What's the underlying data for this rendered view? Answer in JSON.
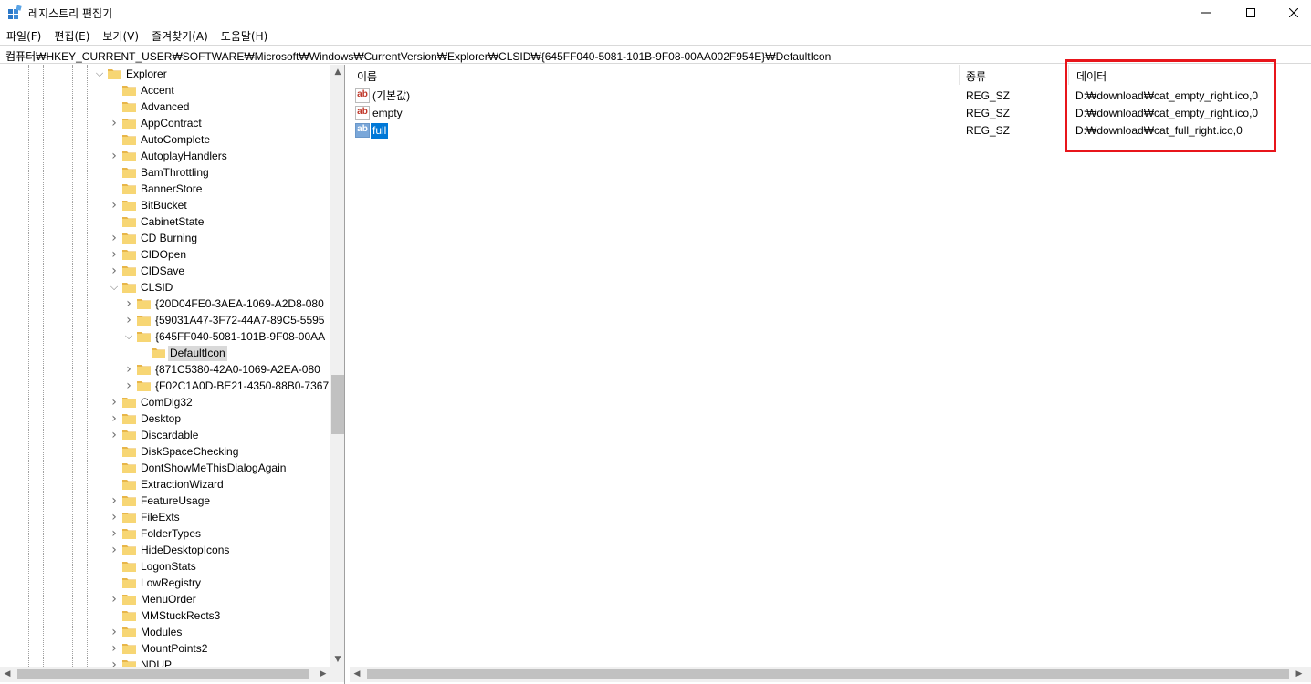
{
  "window": {
    "title": "레지스트리 편집기",
    "controls": {
      "minimize": "—",
      "maximize": "☐",
      "close": "✕"
    }
  },
  "menu": [
    "파일(F)",
    "편집(E)",
    "보기(V)",
    "즐겨찾기(A)",
    "도움말(H)"
  ],
  "address": "컴퓨터₩HKEY_CURRENT_USER₩SOFTWARE₩Microsoft₩Windows₩CurrentVersion₩Explorer₩CLSID₩{645FF040-5081-101B-9F08-00AA002F954E}₩DefaultIcon",
  "tree": {
    "items": [
      {
        "label": "Explorer",
        "level": 0,
        "expander": "open"
      },
      {
        "label": "Accent",
        "level": 1,
        "expander": "none"
      },
      {
        "label": "Advanced",
        "level": 1,
        "expander": "none"
      },
      {
        "label": "AppContract",
        "level": 1,
        "expander": "closed"
      },
      {
        "label": "AutoComplete",
        "level": 1,
        "expander": "none"
      },
      {
        "label": "AutoplayHandlers",
        "level": 1,
        "expander": "closed"
      },
      {
        "label": "BamThrottling",
        "level": 1,
        "expander": "none"
      },
      {
        "label": "BannerStore",
        "level": 1,
        "expander": "none"
      },
      {
        "label": "BitBucket",
        "level": 1,
        "expander": "closed"
      },
      {
        "label": "CabinetState",
        "level": 1,
        "expander": "none"
      },
      {
        "label": "CD Burning",
        "level": 1,
        "expander": "closed"
      },
      {
        "label": "CIDOpen",
        "level": 1,
        "expander": "closed"
      },
      {
        "label": "CIDSave",
        "level": 1,
        "expander": "closed"
      },
      {
        "label": "CLSID",
        "level": 1,
        "expander": "open"
      },
      {
        "label": "{20D04FE0-3AEA-1069-A2D8-080",
        "level": 2,
        "expander": "closed"
      },
      {
        "label": "{59031A47-3F72-44A7-89C5-5595",
        "level": 2,
        "expander": "closed"
      },
      {
        "label": "{645FF040-5081-101B-9F08-00AA",
        "level": 2,
        "expander": "open"
      },
      {
        "label": "DefaultIcon",
        "level": 3,
        "expander": "none",
        "selected": true
      },
      {
        "label": "{871C5380-42A0-1069-A2EA-080",
        "level": 2,
        "expander": "closed"
      },
      {
        "label": "{F02C1A0D-BE21-4350-88B0-7367",
        "level": 2,
        "expander": "closed"
      },
      {
        "label": "ComDlg32",
        "level": 1,
        "expander": "closed"
      },
      {
        "label": "Desktop",
        "level": 1,
        "expander": "closed"
      },
      {
        "label": "Discardable",
        "level": 1,
        "expander": "closed"
      },
      {
        "label": "DiskSpaceChecking",
        "level": 1,
        "expander": "none"
      },
      {
        "label": "DontShowMeThisDialogAgain",
        "level": 1,
        "expander": "none"
      },
      {
        "label": "ExtractionWizard",
        "level": 1,
        "expander": "none"
      },
      {
        "label": "FeatureUsage",
        "level": 1,
        "expander": "closed"
      },
      {
        "label": "FileExts",
        "level": 1,
        "expander": "closed"
      },
      {
        "label": "FolderTypes",
        "level": 1,
        "expander": "closed"
      },
      {
        "label": "HideDesktopIcons",
        "level": 1,
        "expander": "closed"
      },
      {
        "label": "LogonStats",
        "level": 1,
        "expander": "none"
      },
      {
        "label": "LowRegistry",
        "level": 1,
        "expander": "none"
      },
      {
        "label": "MenuOrder",
        "level": 1,
        "expander": "closed"
      },
      {
        "label": "MMStuckRects3",
        "level": 1,
        "expander": "none"
      },
      {
        "label": "Modules",
        "level": 1,
        "expander": "closed"
      },
      {
        "label": "MountPoints2",
        "level": 1,
        "expander": "closed"
      },
      {
        "label": "NDUP",
        "level": 1,
        "expander": "closed"
      }
    ]
  },
  "list": {
    "columns": {
      "name": "이름",
      "type": "종류",
      "data": "데이터"
    },
    "rows": [
      {
        "icon": "string-value-icon",
        "name": "(기본값)",
        "type": "REG_SZ",
        "data": "D:₩download₩cat_empty_right.ico,0",
        "selected": false
      },
      {
        "icon": "string-value-icon",
        "name": "empty",
        "type": "REG_SZ",
        "data": "D:₩download₩cat_empty_right.ico,0",
        "selected": false
      },
      {
        "icon": "string-value-icon",
        "name": "full",
        "type": "REG_SZ",
        "data": "D:₩download₩cat_full_right.ico,0",
        "selected": true
      }
    ],
    "icon_glyph": "ab"
  },
  "colors": {
    "highlight_box": "#e8151b",
    "selection": "#0078d7",
    "folder": "#f7d674"
  }
}
